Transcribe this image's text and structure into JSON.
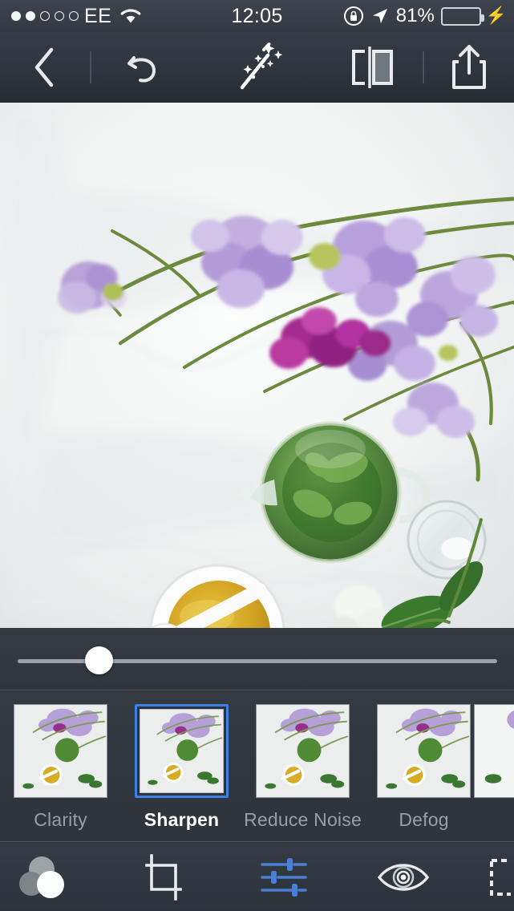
{
  "status_bar": {
    "signal_dots_total": 5,
    "signal_dots_filled": 2,
    "carrier": "EE",
    "wifi_icon": "wifi-icon",
    "time": "12:05",
    "rotation_lock_icon": "rotation-lock-icon",
    "location_icon": "location-arrow-icon",
    "battery_percent": "81%",
    "battery_level": 81,
    "battery_color": "#2fd94a",
    "charging_icon": "lightning-bolt-icon"
  },
  "toolbar": {
    "back_label": "back-chevron-icon",
    "undo_label": "undo-arrow-icon",
    "auto_enhance_label": "magic-wand-icon",
    "compare_label": "before-after-compare-icon",
    "share_label": "share-export-icon"
  },
  "photo": {
    "name": "edited-photo",
    "description": "Flat lay of purple sweet pea flowers, a glass teapot of green mint tea, a white bowl of amber tea with a spoon, an empty glass and mint leaves on white marble",
    "background_color": "#eef0f0"
  },
  "adjustment_slider": {
    "name": "sharpen-amount-slider",
    "value_percent": 17,
    "min": 0,
    "max": 100,
    "track_color": "#9aa1a8",
    "thumb_color": "#ffffff"
  },
  "filter_strip": {
    "selected_index": 1,
    "selection_color": "#3f80e8",
    "items": [
      {
        "label": "Clarity",
        "selected": false
      },
      {
        "label": "Sharpen",
        "selected": true
      },
      {
        "label": "Reduce Noise",
        "selected": false
      },
      {
        "label": "Defog",
        "selected": false
      },
      {
        "label": "",
        "selected": false
      }
    ]
  },
  "bottom_nav": {
    "active_index": 2,
    "active_color": "#4a7fd4",
    "items": [
      {
        "name": "looks-presets-icon",
        "label": "Looks",
        "active": false
      },
      {
        "name": "crop-icon",
        "label": "Crop",
        "active": false
      },
      {
        "name": "adjust-sliders-icon",
        "label": "Adjust",
        "active": true
      },
      {
        "name": "eye-healing-icon",
        "label": "Red Eye",
        "active": false
      },
      {
        "name": "frame-selection-icon",
        "label": "Frame",
        "active": false
      }
    ]
  }
}
